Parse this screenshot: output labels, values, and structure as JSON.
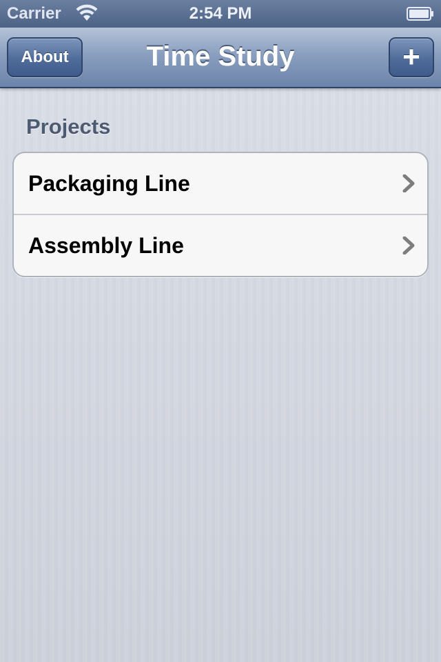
{
  "status_bar": {
    "carrier": "Carrier",
    "time": "2:54 PM",
    "icons": [
      "wifi-icon",
      "battery-icon"
    ]
  },
  "nav_bar": {
    "title": "Time Study",
    "left_button": "About",
    "right_button": "+"
  },
  "projects": {
    "header": "Projects",
    "items": [
      {
        "label": "Packaging Line",
        "accessory": "chevron-right-icon"
      },
      {
        "label": "Assembly Line",
        "accessory": "chevron-right-icon"
      }
    ]
  },
  "colors": {
    "nav_bar": "#6c84aa",
    "background": "#cbd0da",
    "section_header": "#4d5a72"
  }
}
